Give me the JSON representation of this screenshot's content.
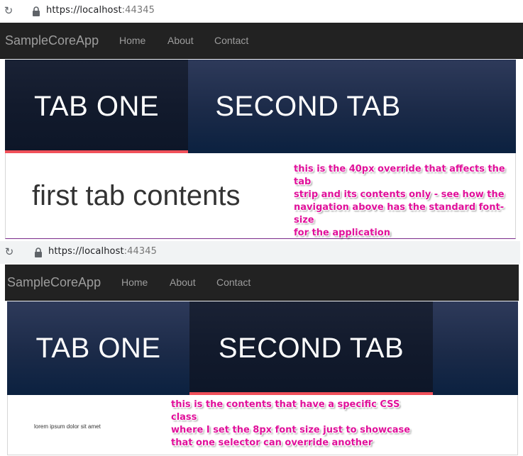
{
  "browser": {
    "url_host": "https://localhost",
    "url_port": ":44345",
    "reload_icon": "reload-icon",
    "lock_icon": "lock-icon"
  },
  "navbar": {
    "brand": "SampleCoreApp",
    "links": [
      "Home",
      "About",
      "Contact"
    ]
  },
  "colors": {
    "navbar_bg": "#222222",
    "tab_bg": "#1b2a48",
    "tab_active_bg": "#121a2c",
    "tab_indicator": "#f0505a",
    "annotation": "#e0109a"
  },
  "screenshot_top": {
    "tabs": [
      {
        "label": "TAB ONE",
        "selected": true
      },
      {
        "label": "SECOND TAB",
        "selected": false
      }
    ],
    "content_text": "first tab contents",
    "annotation": [
      "this is the 40px override that affects the tab",
      "strip and its contents only - see how the",
      "navigation above has the standard font-size",
      "for the application"
    ]
  },
  "screenshot_bottom": {
    "tabs": [
      {
        "label": "TAB ONE",
        "selected": false
      },
      {
        "label": "SECOND TAB",
        "selected": true
      }
    ],
    "content_text": "lorem ipsum dolor sit amet",
    "annotation": [
      "this is the contents that have a specific CSS class",
      "where I set the 8px font size just to showcase",
      "that one selector can override another"
    ]
  }
}
